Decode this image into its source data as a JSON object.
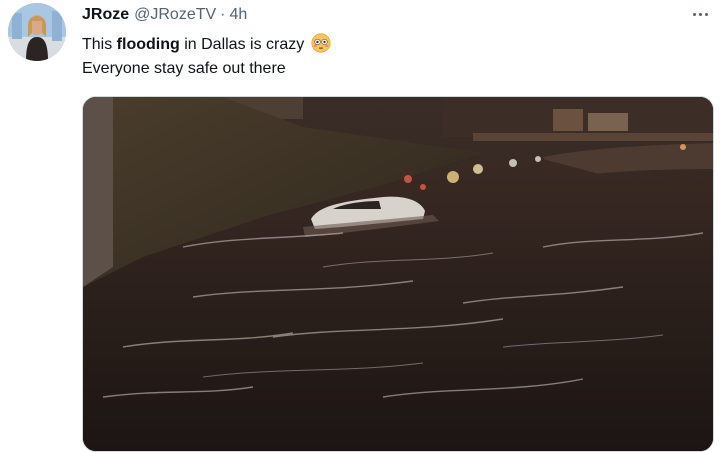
{
  "tweet": {
    "author": {
      "display_name": "JRoze",
      "handle": "@JRozeTV"
    },
    "separator": "·",
    "timestamp": "4h",
    "text_before_bold": "This ",
    "text_bold": "flooding",
    "text_after_bold": " in Dallas is crazy ",
    "text_line2": "Everyone stay safe out there",
    "emoji": "flushed-face-icon",
    "more_icon": "more-horizontal-icon",
    "media_description_icon": "video-thumbnail"
  },
  "colors": {
    "text_primary": "#0f1419",
    "text_secondary": "#536471",
    "border": "#cfd9de"
  }
}
